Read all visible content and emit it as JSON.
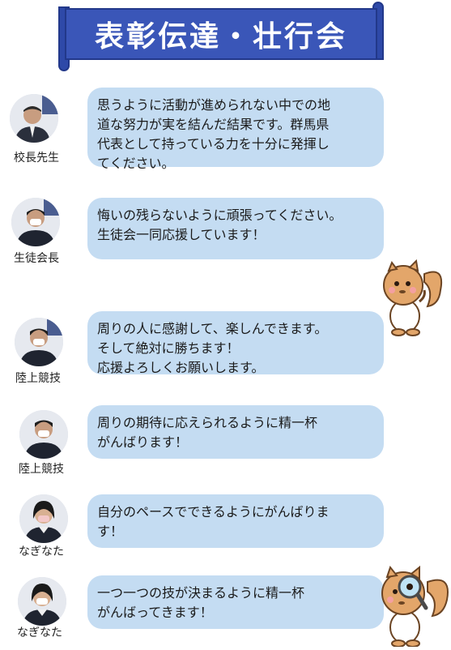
{
  "header": {
    "title": "表彰伝達・壮行会"
  },
  "messages": [
    {
      "role": "校長先生",
      "lines": [
        "思うように活動が進められない中での地",
        "道な努力が実を結んだ結果です。群馬県",
        "代表として持っている力を十分に発揮し",
        "てください。"
      ]
    },
    {
      "role": "生徒会長",
      "lines": [
        "悔いの残らないように頑張ってください。",
        "生徒会一同応援しています！"
      ]
    },
    {
      "role": "陸上競技",
      "lines": [
        "周りの人に感謝して、楽しんできます。",
        "そして絶対に勝ちます！",
        "応援よろしくお願いします。"
      ]
    },
    {
      "role": "陸上競技",
      "lines": [
        "周りの期待に応えられるように精一杯",
        "がんばります！"
      ]
    },
    {
      "role": "なぎなた",
      "lines": [
        "自分のペースでできるようにがんばりま",
        "す！"
      ]
    },
    {
      "role": "なぎなた",
      "lines": [
        "一つ一つの技が決まるように精一杯",
        "がんばってきます！"
      ]
    }
  ],
  "colors": {
    "banner": "#3a56b8",
    "bubble": "#c4dcf2"
  },
  "icons": [
    "squirrel-mascot-thinking-icon",
    "squirrel-mascot-magnifier-icon"
  ]
}
